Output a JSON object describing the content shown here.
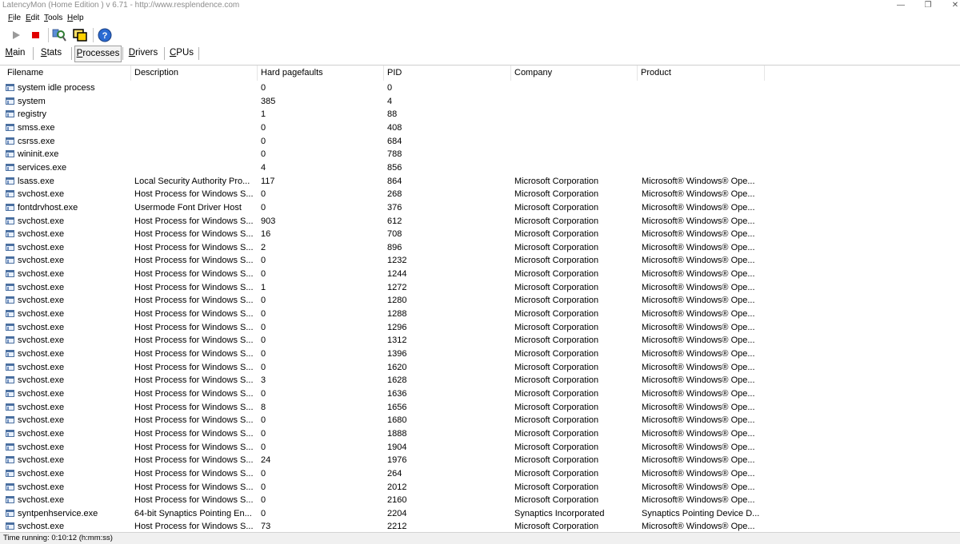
{
  "window": {
    "title": "LatencyMon  (Home Edition )  v 6.71 - http://www.resplendence.com",
    "minimize_glyph": "—",
    "maximize_glyph": "❐",
    "close_glyph": "✕"
  },
  "menu": [
    {
      "name": "menu-file",
      "label": "File",
      "underline": "F"
    },
    {
      "name": "menu-edit",
      "label": "Edit",
      "underline": "E"
    },
    {
      "name": "menu-tools",
      "label": "Tools",
      "underline": "T"
    },
    {
      "name": "menu-help",
      "label": "Help",
      "underline": "H"
    }
  ],
  "toolbar": {
    "play_icon": "play-icon",
    "stop_icon": "stop-icon",
    "search_icon": "search-icon",
    "windows_icon": "windows-icon",
    "help_icon": "help-icon",
    "accent": "#2a6ad2",
    "stop_color": "#e00000"
  },
  "tabs": [
    {
      "name": "tab-main",
      "label": "Main",
      "underline": "M",
      "active": false
    },
    {
      "name": "tab-stats",
      "label": "Stats",
      "underline": "S",
      "active": false
    },
    {
      "name": "tab-processes",
      "label": "Processes",
      "underline": "P",
      "active": true
    },
    {
      "name": "tab-drivers",
      "label": "Drivers",
      "underline": "D",
      "active": false
    },
    {
      "name": "tab-cpus",
      "label": "CPUs",
      "underline": "C",
      "active": false
    }
  ],
  "columns": [
    "Filename",
    "Description",
    "Hard pagefaults",
    "PID",
    "Company",
    "Product"
  ],
  "rows": [
    [
      "system idle process",
      "",
      "0",
      "0",
      "",
      ""
    ],
    [
      "system",
      "",
      "385",
      "4",
      "",
      ""
    ],
    [
      "registry",
      "",
      "1",
      "88",
      "",
      ""
    ],
    [
      "smss.exe",
      "",
      "0",
      "408",
      "",
      ""
    ],
    [
      "csrss.exe",
      "",
      "0",
      "684",
      "",
      ""
    ],
    [
      "wininit.exe",
      "",
      "0",
      "788",
      "",
      ""
    ],
    [
      "services.exe",
      "",
      "4",
      "856",
      "",
      ""
    ],
    [
      "lsass.exe",
      "Local Security Authority Pro...",
      "117",
      "864",
      "Microsoft Corporation",
      "Microsoft® Windows® Ope..."
    ],
    [
      "svchost.exe",
      "Host Process for Windows S...",
      "0",
      "268",
      "Microsoft Corporation",
      "Microsoft® Windows® Ope..."
    ],
    [
      "fontdrvhost.exe",
      "Usermode Font Driver Host",
      "0",
      "376",
      "Microsoft Corporation",
      "Microsoft® Windows® Ope..."
    ],
    [
      "svchost.exe",
      "Host Process for Windows S...",
      "903",
      "612",
      "Microsoft Corporation",
      "Microsoft® Windows® Ope..."
    ],
    [
      "svchost.exe",
      "Host Process for Windows S...",
      "16",
      "708",
      "Microsoft Corporation",
      "Microsoft® Windows® Ope..."
    ],
    [
      "svchost.exe",
      "Host Process for Windows S...",
      "2",
      "896",
      "Microsoft Corporation",
      "Microsoft® Windows® Ope..."
    ],
    [
      "svchost.exe",
      "Host Process for Windows S...",
      "0",
      "1232",
      "Microsoft Corporation",
      "Microsoft® Windows® Ope..."
    ],
    [
      "svchost.exe",
      "Host Process for Windows S...",
      "0",
      "1244",
      "Microsoft Corporation",
      "Microsoft® Windows® Ope..."
    ],
    [
      "svchost.exe",
      "Host Process for Windows S...",
      "1",
      "1272",
      "Microsoft Corporation",
      "Microsoft® Windows® Ope..."
    ],
    [
      "svchost.exe",
      "Host Process for Windows S...",
      "0",
      "1280",
      "Microsoft Corporation",
      "Microsoft® Windows® Ope..."
    ],
    [
      "svchost.exe",
      "Host Process for Windows S...",
      "0",
      "1288",
      "Microsoft Corporation",
      "Microsoft® Windows® Ope..."
    ],
    [
      "svchost.exe",
      "Host Process for Windows S...",
      "0",
      "1296",
      "Microsoft Corporation",
      "Microsoft® Windows® Ope..."
    ],
    [
      "svchost.exe",
      "Host Process for Windows S...",
      "0",
      "1312",
      "Microsoft Corporation",
      "Microsoft® Windows® Ope..."
    ],
    [
      "svchost.exe",
      "Host Process for Windows S...",
      "0",
      "1396",
      "Microsoft Corporation",
      "Microsoft® Windows® Ope..."
    ],
    [
      "svchost.exe",
      "Host Process for Windows S...",
      "0",
      "1620",
      "Microsoft Corporation",
      "Microsoft® Windows® Ope..."
    ],
    [
      "svchost.exe",
      "Host Process for Windows S...",
      "3",
      "1628",
      "Microsoft Corporation",
      "Microsoft® Windows® Ope..."
    ],
    [
      "svchost.exe",
      "Host Process for Windows S...",
      "0",
      "1636",
      "Microsoft Corporation",
      "Microsoft® Windows® Ope..."
    ],
    [
      "svchost.exe",
      "Host Process for Windows S...",
      "8",
      "1656",
      "Microsoft Corporation",
      "Microsoft® Windows® Ope..."
    ],
    [
      "svchost.exe",
      "Host Process for Windows S...",
      "0",
      "1680",
      "Microsoft Corporation",
      "Microsoft® Windows® Ope..."
    ],
    [
      "svchost.exe",
      "Host Process for Windows S...",
      "0",
      "1888",
      "Microsoft Corporation",
      "Microsoft® Windows® Ope..."
    ],
    [
      "svchost.exe",
      "Host Process for Windows S...",
      "0",
      "1904",
      "Microsoft Corporation",
      "Microsoft® Windows® Ope..."
    ],
    [
      "svchost.exe",
      "Host Process for Windows S...",
      "24",
      "1976",
      "Microsoft Corporation",
      "Microsoft® Windows® Ope..."
    ],
    [
      "svchost.exe",
      "Host Process for Windows S...",
      "0",
      "264",
      "Microsoft Corporation",
      "Microsoft® Windows® Ope..."
    ],
    [
      "svchost.exe",
      "Host Process for Windows S...",
      "0",
      "2012",
      "Microsoft Corporation",
      "Microsoft® Windows® Ope..."
    ],
    [
      "svchost.exe",
      "Host Process for Windows S...",
      "0",
      "2160",
      "Microsoft Corporation",
      "Microsoft® Windows® Ope..."
    ],
    [
      "syntpenhservice.exe",
      "64-bit Synaptics Pointing En...",
      "0",
      "2204",
      "Synaptics Incorporated",
      "Synaptics Pointing Device D..."
    ],
    [
      "svchost.exe",
      "Host Process for Windows S...",
      "73",
      "2212",
      "Microsoft Corporation",
      "Microsoft® Windows® Ope..."
    ]
  ],
  "status": {
    "text": "Time running: 0:10:12  (h:mm:ss)"
  }
}
